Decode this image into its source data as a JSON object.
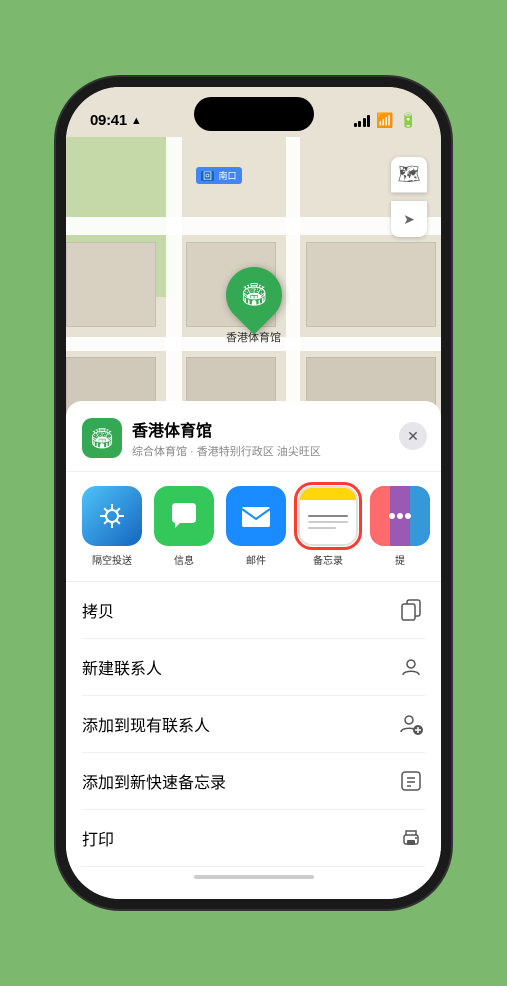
{
  "phone": {
    "status_bar": {
      "time": "09:41",
      "location_arrow": "▲"
    },
    "map": {
      "road_label": "南口",
      "road_prefix": "回",
      "venue_name": "香港体育馆",
      "controls": {
        "map_icon": "🗺",
        "location_icon": "➤"
      }
    },
    "bottom_sheet": {
      "close_icon": "✕",
      "venue_icon": "🏟",
      "title": "香港体育馆",
      "subtitle": "综合体育馆 · 香港特别行政区 油尖旺区",
      "share_apps": [
        {
          "id": "airdrop",
          "label": "隔空投送"
        },
        {
          "id": "messages",
          "label": "信息"
        },
        {
          "id": "mail",
          "label": "邮件"
        },
        {
          "id": "notes",
          "label": "备忘录",
          "selected": true
        },
        {
          "id": "more",
          "label": "提"
        }
      ],
      "actions": [
        {
          "id": "copy",
          "label": "拷贝",
          "icon": "⧉"
        },
        {
          "id": "new-contact",
          "label": "新建联系人",
          "icon": "👤"
        },
        {
          "id": "add-existing",
          "label": "添加到现有联系人",
          "icon": "👤"
        },
        {
          "id": "add-quicknote",
          "label": "添加到新快速备忘录",
          "icon": "⊡"
        },
        {
          "id": "print",
          "label": "打印",
          "icon": "🖨"
        }
      ]
    }
  }
}
